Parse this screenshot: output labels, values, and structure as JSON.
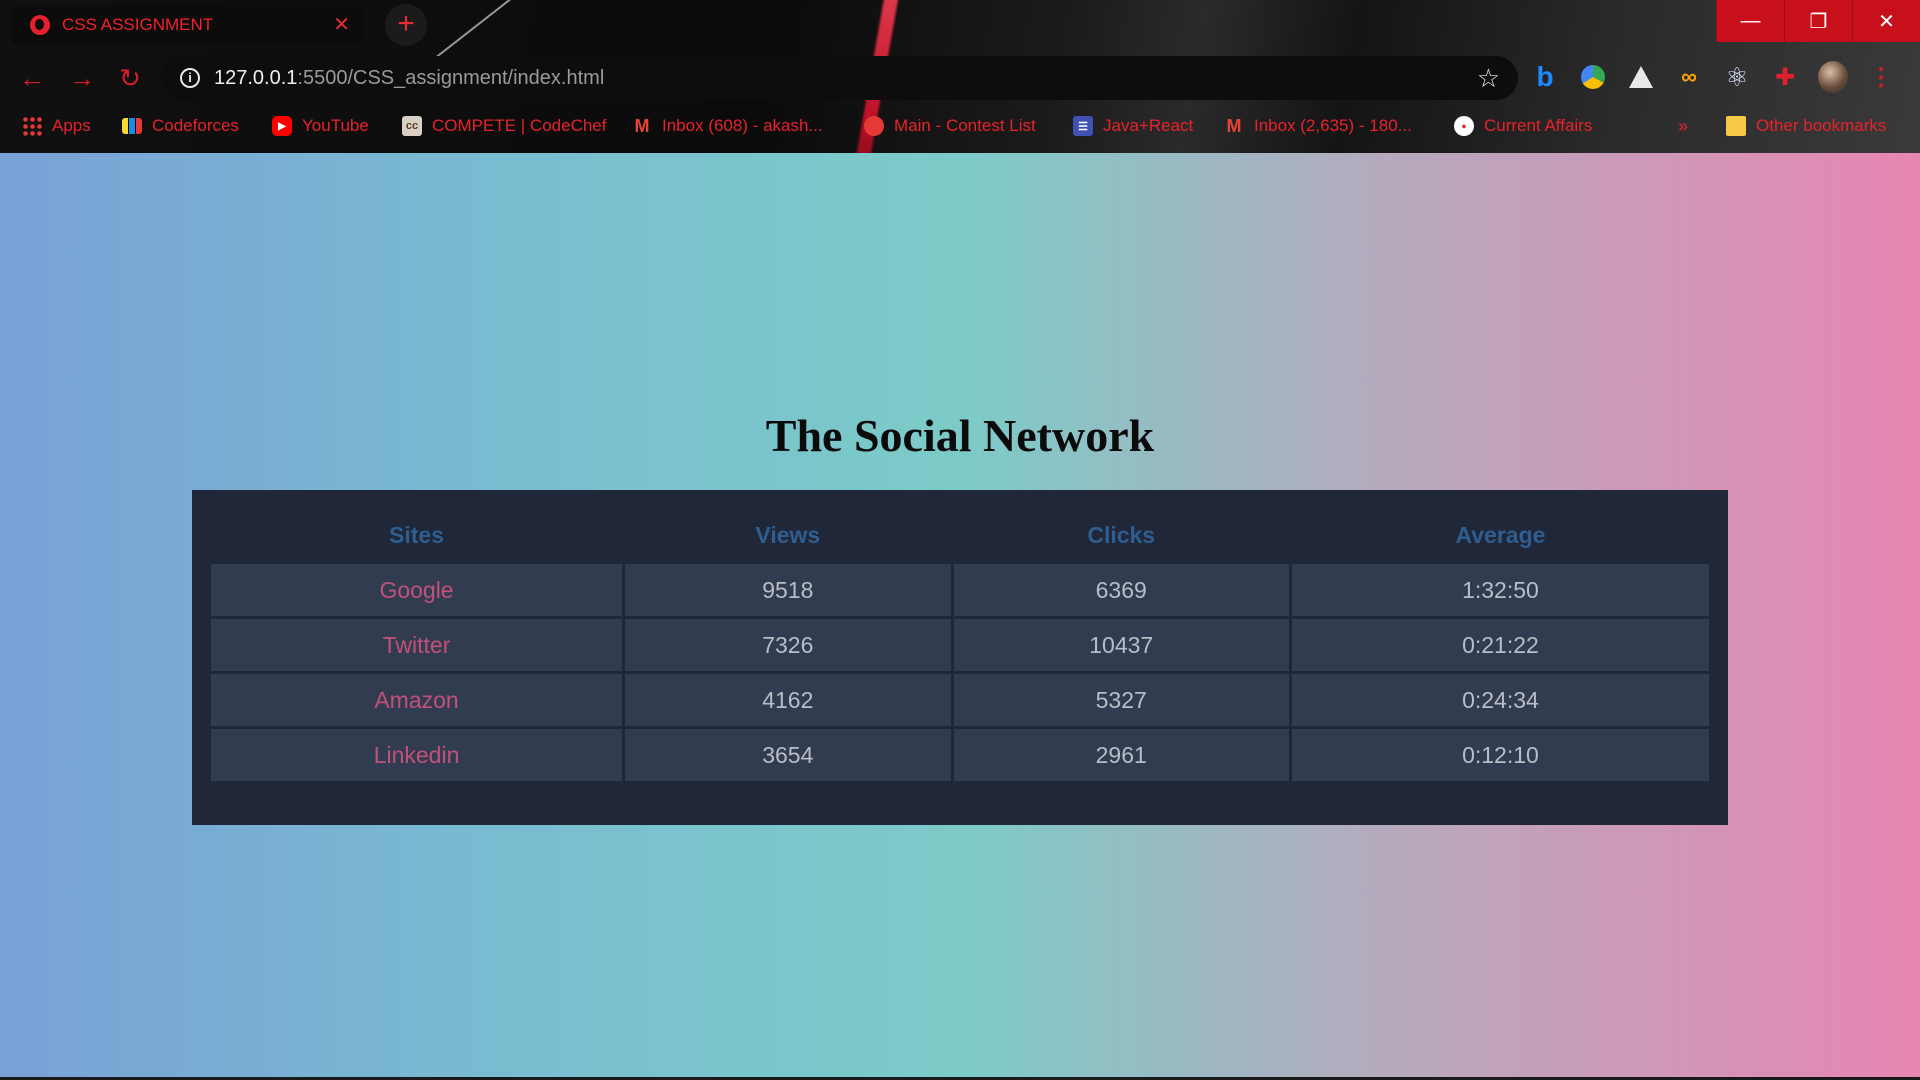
{
  "browser": {
    "tab_title": "CSS ASSIGNMENT",
    "tab_close": "✕",
    "new_tab": "+",
    "url_host": "127.0.0.1",
    "url_rest": ":5500/CSS_assignment/index.html",
    "window_controls": {
      "minimize": "—",
      "restore": "❐",
      "close": "✕"
    },
    "nav": {
      "back": "←",
      "forward": "→",
      "reload": "↻"
    },
    "bookmarks": [
      {
        "label": "Apps",
        "icon": "apps-grid-icon"
      },
      {
        "label": "Codeforces",
        "icon": "codeforces-icon"
      },
      {
        "label": "YouTube",
        "icon": "youtube-icon"
      },
      {
        "label": "COMPETE | CodeChef",
        "icon": "codechef-icon"
      },
      {
        "label": "Inbox (608) - akash...",
        "icon": "gmail-icon"
      },
      {
        "label": "Main - Contest List",
        "icon": "contest-icon"
      },
      {
        "label": "Java+React",
        "icon": "java-react-icon"
      },
      {
        "label": "Inbox (2,635) - 180...",
        "icon": "gmail-icon"
      },
      {
        "label": "Current Affairs",
        "icon": "current-affairs-icon"
      }
    ],
    "bookmarks_more": "»",
    "other_bookmarks": "Other bookmarks"
  },
  "page": {
    "title": "The Social Network",
    "table": {
      "headers": [
        "Sites",
        "Views",
        "Clicks",
        "Average"
      ],
      "rows": [
        {
          "site": "Google",
          "views": "9518",
          "clicks": "6369",
          "average": "1:32:50"
        },
        {
          "site": "Twitter",
          "views": "7326",
          "clicks": "10437",
          "average": "0:21:22"
        },
        {
          "site": "Amazon",
          "views": "4162",
          "clicks": "5327",
          "average": "0:24:34"
        },
        {
          "site": "Linkedin",
          "views": "3654",
          "clicks": "2961",
          "average": "0:12:10"
        }
      ]
    }
  },
  "colors": {
    "accent_red": "#e8222c",
    "table_bg": "#1f2739",
    "cell_bg": "#323c50",
    "header_text": "#2f5d8f",
    "site_text": "#c0517a",
    "cell_text": "#b8bdc7"
  }
}
